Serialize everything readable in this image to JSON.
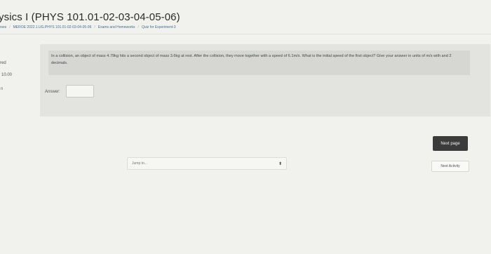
{
  "header": {
    "title": "ysics I (PHYS 101.01-02-03-04-05-06)",
    "breadcrumb": {
      "courses": "urses",
      "course_code": "MEROE 2022.1.UG.PHYS 101.01-02-03-04-05-06",
      "section": "Exams and Homeworks",
      "quiz": "Quiz for Experiment-3"
    }
  },
  "question_info": {
    "status": "red",
    "mark": "10.00",
    "flag": "n"
  },
  "question": {
    "text": "In a collision, an object of mass 4.79kg hits a second object of mass 3.6kg at rest. After the collision, they move together with a speed of 6.1m/s. What is the initial speed of the first object? Give your answer in units of m/s with and 2 decimals.",
    "answer_label": "Answer:",
    "answer_value": ""
  },
  "navigation": {
    "next_page": "Next page",
    "jump_to": "Jump to...",
    "next_activity": "Next Activity"
  }
}
